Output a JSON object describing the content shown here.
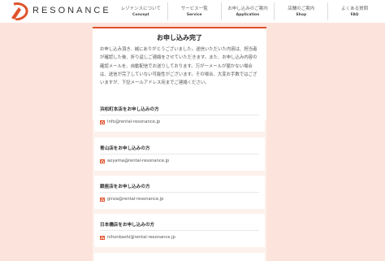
{
  "brand": {
    "name": "RESONANCE",
    "accent_color": "#e0522c",
    "logo_icon": "resonance-logo-icon"
  },
  "nav": [
    {
      "jp": "レゾナンスについて",
      "en": "Concept"
    },
    {
      "jp": "サービス一覧",
      "en": "Service"
    },
    {
      "jp": "お申し込みのご案内",
      "en": "Application"
    },
    {
      "jp": "店舗のご案内",
      "en": "Shop"
    },
    {
      "jp": "よくある質問",
      "en": "FAQ"
    }
  ],
  "complete": {
    "title": "お申し込み完了",
    "body": "お申し込み頂き、誠にありがとうございました。送信いただいた内容は、担当者が確認した後、折り返しご連絡をさせていただきます。また、お申し込み内容の確認メールを、自動配信でお送りしております。万が一メールが届かない場合は、送信が完了していない可能性がございます。その場合、大変お手数ではございますが、下記メールアドレス宛までご連絡ください。"
  },
  "stores": [
    {
      "title": "浜松町本店をお申し込みの方",
      "email": "info@rental-resonance.jp",
      "icon": "mail-icon"
    },
    {
      "title": "青山店をお申し込みの方",
      "email": "aoyama@rental-resonance.jp",
      "icon": "mail-icon"
    },
    {
      "title": "銀座店をお申し込みの方",
      "email": "ginza@rental-resonance.jp",
      "icon": "mail-icon"
    },
    {
      "title": "日本橋店をお申し込みの方",
      "email": "nihonbashi@rental-resonance.jp",
      "icon": "mail-icon"
    }
  ]
}
